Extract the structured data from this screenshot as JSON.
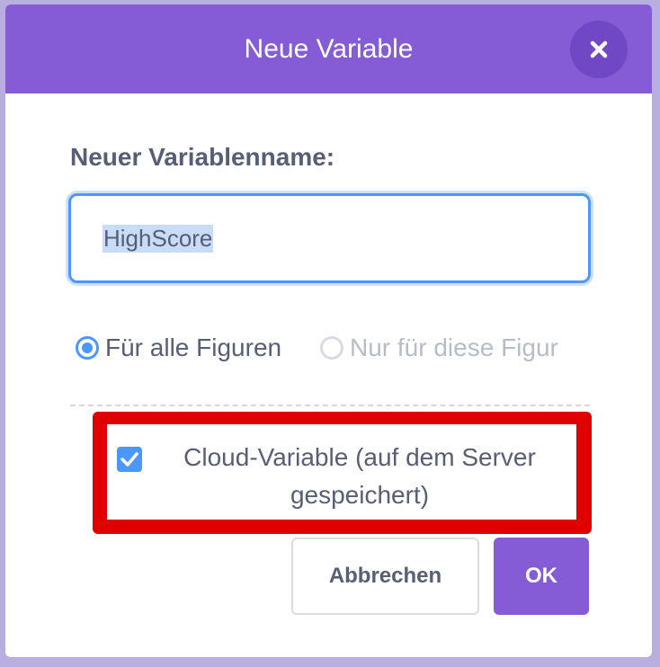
{
  "dialog": {
    "title": "Neue Variable",
    "close_icon": "close-icon"
  },
  "form": {
    "name_label": "Neuer Variablenname:",
    "name_value": "HighScore",
    "scope": {
      "all_sprites_label": "Für alle Figuren",
      "this_sprite_label": "Nur für diese Figur",
      "selected": "all_sprites"
    },
    "cloud": {
      "label": "Cloud-Variable (auf dem Server gespeichert)",
      "checked": true
    }
  },
  "buttons": {
    "cancel_label": "Abbrechen",
    "ok_label": "OK"
  },
  "colors": {
    "header": "#855cd6",
    "accent_blue": "#4c97ff",
    "text": "#575e75",
    "highlight": "#e00000"
  }
}
